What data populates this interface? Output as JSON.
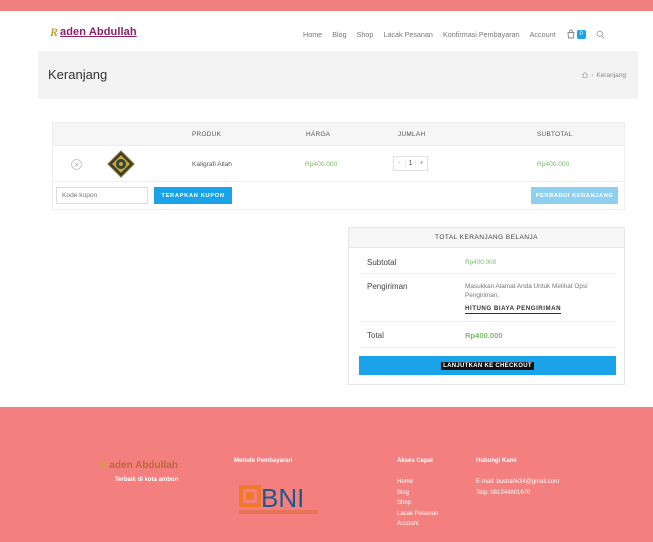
{
  "brand": {
    "logo_mark": "R",
    "logo_text": "aden Abdullah"
  },
  "nav": {
    "items": [
      "Home",
      "Blog",
      "Shop",
      "Lacak Pesanan",
      "Konfirmasi Pembayaran",
      "Account"
    ],
    "cart_count": "0"
  },
  "page": {
    "title": "Keranjang",
    "breadcrumb": "Keranjang"
  },
  "cart": {
    "headers": {
      "product": "PRODUK",
      "price": "HARGA",
      "qty": "JUMLAH",
      "subtotal": "SUBTOTAL"
    },
    "items": [
      {
        "name": "Kaligrafi Allah",
        "price": "Rp400.000",
        "qty": "1",
        "subtotal": "Rp400.000"
      }
    ],
    "coupon_placeholder": "Kode kupon",
    "apply_label": "TERAPKAN KUPON",
    "update_label": "PERBARUI KERANJANG"
  },
  "totals": {
    "heading": "TOTAL KERANJANG BELANJA",
    "subtotal_label": "Subtotal",
    "subtotal_value": "Rp400.000",
    "shipping_label": "Pengiriman",
    "shipping_note": "Masukkan Alamat Anda Untuk Melihat Opsi Pengiriman.",
    "shipping_link": "HITUNG BIAYA PENGIRIMAN",
    "total_label": "Total",
    "total_value": "Rp400.000",
    "checkout_label": "LANJUTKAN KE CHECKOUT"
  },
  "footer": {
    "logo_mark": "R",
    "logo_text": "aden Abdullah",
    "tagline": "Terbaik di kota ambon",
    "payment_heading": "Metode Pembayaran",
    "quick_heading": "Akses Cepat",
    "quick_links": [
      "Home",
      "Blog",
      "Shop",
      "Lacak Pesanan",
      "Account"
    ],
    "contact_heading": "Hubungi Kami",
    "email": "E-mail: bushahk34@gmail.com",
    "phone": "Telp: 081344801670",
    "bni_text": "BNI"
  },
  "colors": {
    "accent": "#1aa3e8",
    "price": "#7dba6a",
    "footer": "#f47f7f"
  }
}
